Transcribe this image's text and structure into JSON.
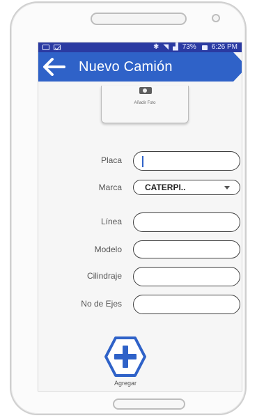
{
  "status_bar": {
    "battery": "73%",
    "time": "6:26 PM"
  },
  "app_bar": {
    "title": "Nuevo Camión"
  },
  "photo": {
    "label": "Añadir Foto"
  },
  "form": {
    "fields": [
      {
        "label": "Placa",
        "value": ""
      },
      {
        "label": "Marca",
        "value": "CATERPI.."
      },
      {
        "label": "Línea",
        "value": ""
      },
      {
        "label": "Modelo",
        "value": ""
      },
      {
        "label": "Cilindraje",
        "value": ""
      },
      {
        "label": "No de Ejes",
        "value": ""
      }
    ]
  },
  "actions": {
    "add_label": "Agregar"
  },
  "colors": {
    "primary": "#2f62c8",
    "status_bar": "#2a3aa2"
  }
}
